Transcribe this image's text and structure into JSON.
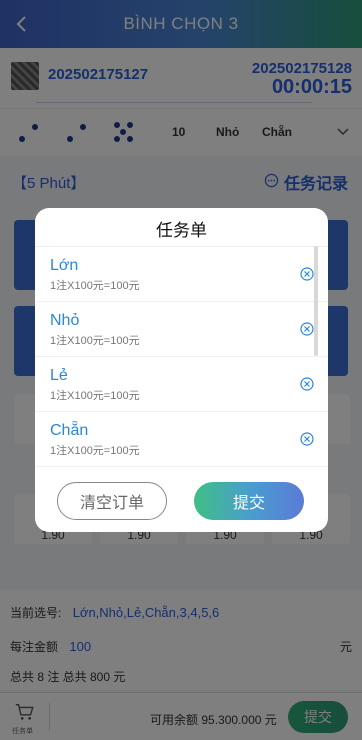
{
  "header": {
    "title": "BÌNH CHỌN 3"
  },
  "period": {
    "current": "202502175127",
    "next": "202502175128",
    "countdown": "00:00:15"
  },
  "result": {
    "dice": [
      2,
      2,
      5
    ],
    "number": "10",
    "size": "Nhỏ",
    "parity": "Chẵn"
  },
  "mode": {
    "label": "【5 Phút】",
    "record_label": "任务记录"
  },
  "board": {
    "odds": [
      "1.90",
      "1.90",
      "1.90",
      "1.90"
    ]
  },
  "summary": {
    "selected_label": "当前选号:",
    "selected_value": "Lớn,Nhỏ,Lẻ,Chẵn,3,4,5,6",
    "amount_label": "每注金额",
    "amount_value": "100",
    "currency": "元",
    "total_text": "总共 8 注  总共 800 元"
  },
  "bottom": {
    "cart_label": "任务单",
    "balance_label": "可用余额",
    "balance_value": "95.300.000 元",
    "submit_label": "提交"
  },
  "modal": {
    "title": "任务单",
    "items": [
      {
        "name": "Lớn",
        "detail": "1注X100元=100元"
      },
      {
        "name": "Nhỏ",
        "detail": "1注X100元=100元"
      },
      {
        "name": "Lẻ",
        "detail": "1注X100元=100元"
      },
      {
        "name": "Chẵn",
        "detail": "1注X100元=100元"
      }
    ],
    "clear_label": "清空订单",
    "submit_label": "提交"
  }
}
